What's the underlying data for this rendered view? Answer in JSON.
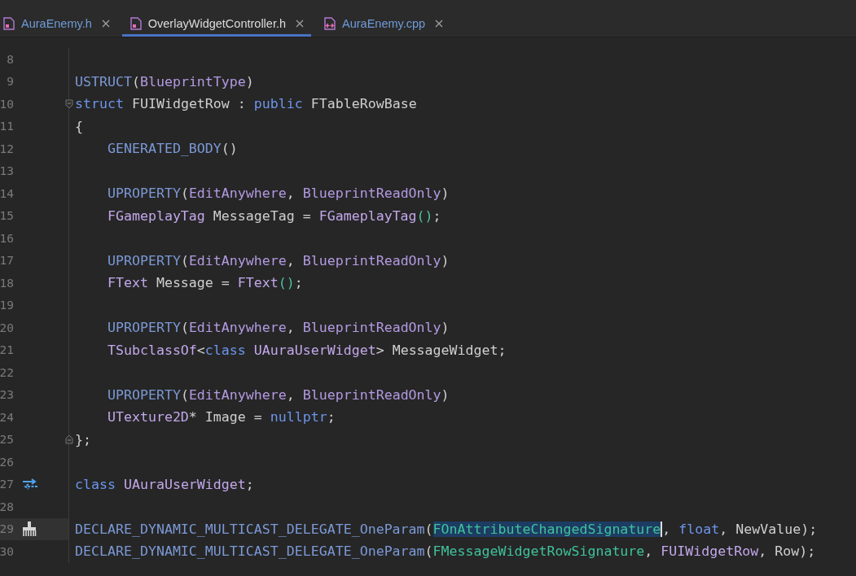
{
  "tabs": [
    {
      "label": "AuraEnemy.h",
      "kind": "header",
      "selected": false,
      "modified": true
    },
    {
      "label": "OverlayWidgetController.h",
      "kind": "header",
      "selected": true,
      "modified": false
    },
    {
      "label": "AuraEnemy.cpp",
      "kind": "source",
      "selected": false,
      "modified": true
    }
  ],
  "editor": {
    "lines": [
      {
        "number": "8",
        "current": false
      },
      {
        "number": "9",
        "current": false,
        "tokens": [
          {
            "text": "USTRUCT",
            "kind": "macro"
          },
          {
            "text": "(",
            "kind": "plain"
          },
          {
            "text": "BlueprintType",
            "kind": "param"
          },
          {
            "text": ")",
            "kind": "plain"
          }
        ]
      },
      {
        "number": "10",
        "current": false,
        "fold": {
          "kind": "start"
        },
        "tokens": [
          {
            "text": "struct",
            "kind": "keyword"
          },
          {
            "text": " FUIWidgetRow : ",
            "kind": "plain"
          },
          {
            "text": "public",
            "kind": "keyword"
          },
          {
            "text": " FTableRowBase",
            "kind": "plain"
          }
        ]
      },
      {
        "number": "11",
        "current": false,
        "tokens": [
          {
            "text": "{",
            "kind": "plain"
          }
        ],
        "children": [
          {
            "number": "12",
            "current": false,
            "tokens": [
              {
                "text": "GENERATED_BODY",
                "kind": "macro"
              },
              {
                "text": "()",
                "kind": "plain"
              }
            ]
          },
          {
            "number": "13",
            "current": false
          },
          {
            "number": "14",
            "current": false,
            "tokens": [
              {
                "text": "UPROPERTY",
                "kind": "macro"
              },
              {
                "text": "(",
                "kind": "plain"
              },
              {
                "text": "EditAnywhere",
                "kind": "param"
              },
              {
                "text": ", ",
                "kind": "plain"
              },
              {
                "text": "BlueprintReadOnly",
                "kind": "param"
              },
              {
                "text": ")",
                "kind": "plain"
              }
            ]
          },
          {
            "number": "15",
            "current": false,
            "tokens": [
              {
                "text": "FGameplayTag",
                "kind": "type"
              },
              {
                "text": " MessageTag = ",
                "kind": "plain"
              },
              {
                "text": "FGameplayTag",
                "kind": "type"
              },
              {
                "text": "()",
                "kind": "call"
              },
              {
                "text": ";",
                "kind": "plain"
              }
            ]
          },
          {
            "number": "16",
            "current": false
          },
          {
            "number": "17",
            "current": false,
            "tokens": [
              {
                "text": "UPROPERTY",
                "kind": "macro"
              },
              {
                "text": "(",
                "kind": "plain"
              },
              {
                "text": "EditAnywhere",
                "kind": "param"
              },
              {
                "text": ", ",
                "kind": "plain"
              },
              {
                "text": "BlueprintReadOnly",
                "kind": "param"
              },
              {
                "text": ")",
                "kind": "plain"
              }
            ]
          },
          {
            "number": "18",
            "current": false,
            "tokens": [
              {
                "text": "FText",
                "kind": "type"
              },
              {
                "text": " Message = ",
                "kind": "plain"
              },
              {
                "text": "FText",
                "kind": "type"
              },
              {
                "text": "()",
                "kind": "call"
              },
              {
                "text": ";",
                "kind": "plain"
              }
            ]
          },
          {
            "number": "19",
            "current": false
          },
          {
            "number": "20",
            "current": false,
            "tokens": [
              {
                "text": "UPROPERTY",
                "kind": "macro"
              },
              {
                "text": "(",
                "kind": "plain"
              },
              {
                "text": "EditAnywhere",
                "kind": "param"
              },
              {
                "text": ", ",
                "kind": "plain"
              },
              {
                "text": "BlueprintReadOnly",
                "kind": "param"
              },
              {
                "text": ")",
                "kind": "plain"
              }
            ]
          },
          {
            "number": "21",
            "current": false,
            "tokens": [
              {
                "text": "TSubclassOf",
                "kind": "type"
              },
              {
                "text": "<",
                "kind": "plain"
              },
              {
                "text": "class",
                "kind": "keyword"
              },
              {
                "text": " UAuraUserWidget",
                "kind": "type"
              },
              {
                "text": "> MessageWidget;",
                "kind": "plain"
              }
            ]
          },
          {
            "number": "22",
            "current": false
          },
          {
            "number": "23",
            "current": false,
            "tokens": [
              {
                "text": "UPROPERTY",
                "kind": "macro"
              },
              {
                "text": "(",
                "kind": "plain"
              },
              {
                "text": "EditAnywhere",
                "kind": "param"
              },
              {
                "text": ", ",
                "kind": "plain"
              },
              {
                "text": "BlueprintReadOnly",
                "kind": "param"
              },
              {
                "text": ")",
                "kind": "plain"
              }
            ]
          },
          {
            "number": "24",
            "current": false,
            "tokens": [
              {
                "text": "UTexture2D",
                "kind": "type"
              },
              {
                "text": "* Image = ",
                "kind": "plain"
              },
              {
                "text": "nullptr",
                "kind": "keyword"
              },
              {
                "text": ";",
                "kind": "plain"
              }
            ]
          }
        ]
      },
      {
        "number": "25",
        "current": false,
        "fold": {
          "kind": "end"
        },
        "tokens": [
          {
            "text": "};",
            "kind": "plain"
          }
        ]
      },
      {
        "number": "26",
        "current": false
      },
      {
        "number": "27",
        "current": false,
        "gutter_icon": {
          "kind": "arrows"
        },
        "tokens": [
          {
            "text": "class",
            "kind": "keyword"
          },
          {
            "text": " UAuraUserWidget",
            "kind": "type"
          },
          {
            "text": ";",
            "kind": "plain"
          }
        ]
      },
      {
        "number": "28",
        "current": false
      },
      {
        "number": "29",
        "current": true,
        "gutter_icon": {
          "kind": "brush"
        },
        "tokens": [
          {
            "text": "DECLARE_DYNAMIC_MULTICAST_DELEGATE_OneParam",
            "kind": "macro"
          },
          {
            "text": "(",
            "kind": "plain"
          },
          {
            "text": "FOnAttributeChangedSignature",
            "kind": "selection"
          },
          {
            "text": ", ",
            "kind": "plain"
          },
          {
            "text": "float",
            "kind": "keyword"
          },
          {
            "text": ", NewValue);",
            "kind": "plain"
          }
        ]
      },
      {
        "number": "30",
        "current": false,
        "tokens": [
          {
            "text": "DECLARE_DYNAMIC_MULTICAST_DELEGATE_OneParam",
            "kind": "macro"
          },
          {
            "text": "(",
            "kind": "plain"
          },
          {
            "text": "FMessageWidgetRowSignature",
            "kind": "delegate"
          },
          {
            "text": ", ",
            "kind": "plain"
          },
          {
            "text": "FUIWidgetRow",
            "kind": "type"
          },
          {
            "text": ", Row);",
            "kind": "plain"
          }
        ]
      }
    ]
  }
}
